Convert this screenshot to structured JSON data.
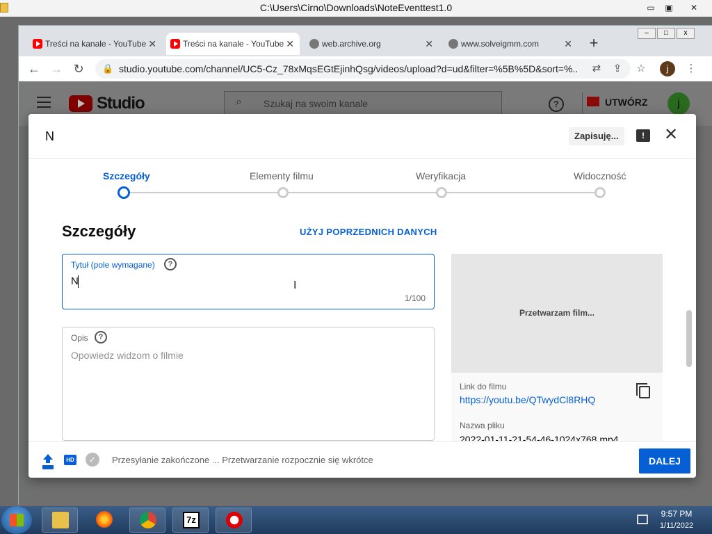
{
  "outer_window": {
    "title": "C:\\Users\\Cirno\\Downloads\\NoteEventtest1.0",
    "min": "▭",
    "max": "▣",
    "close": "✕"
  },
  "browser": {
    "tabs": [
      {
        "label": "Treści na kanale - YouTube",
        "icon": "youtube-icon"
      },
      {
        "label": "Treści na kanale - YouTube",
        "icon": "youtube-icon",
        "active": true
      },
      {
        "label": "web.archive.org",
        "icon": "globe-icon"
      },
      {
        "label": "www.solveigmm.com",
        "icon": "globe-icon"
      }
    ],
    "tab_close": "✕",
    "new_tab": "+",
    "url": "studio.youtube.com/channel/UC5-Cz_78xMqsEGtEjinhQsg/videos/upload?d=ud&filter=%5B%5D&sort=%...",
    "profile_initial": "j"
  },
  "studio": {
    "brand": "Studio",
    "search_placeholder": "Szukaj na swoim kanale",
    "create_label": "UTWÓRZ",
    "avatar_initial": "j"
  },
  "dialog": {
    "title": "N",
    "saving": "Zapisuję...",
    "feedback_glyph": "!",
    "close_glyph": "✕",
    "steps": [
      {
        "label": "Szczegóły",
        "active": true
      },
      {
        "label": "Elementy filmu"
      },
      {
        "label": "Weryfikacja"
      },
      {
        "label": "Widoczność"
      }
    ],
    "section_title": "Szczegóły",
    "reuse_label": "UŻYJ POPRZEDNICH DANYCH",
    "title_field": {
      "label": "Tytuł (pole wymagane)",
      "value": "N",
      "counter": "1/100"
    },
    "description_field": {
      "label": "Opis",
      "placeholder": "Opowiedz widzom o filmie"
    },
    "preview": {
      "processing": "Przetwarzam film...",
      "link_label": "Link do filmu",
      "link_value": "https://youtu.be/QTwydCl8RHQ",
      "filename_label": "Nazwa pliku",
      "filename_value": "2022-01-11-21-54-46-1024x768.mp4"
    },
    "footer": {
      "hd_label": "HD",
      "check_glyph": "✓",
      "status": "Przesyłanie zakończone ... Przetwarzanie rozpocznie się wkrótce",
      "next_label": "DALEJ"
    }
  },
  "taskbar": {
    "time": "9:57 PM",
    "date": "1/11/2022",
    "app_7z": "7z"
  },
  "colors": {
    "accent": "#065fd4",
    "youtube_red": "#ff0000"
  }
}
